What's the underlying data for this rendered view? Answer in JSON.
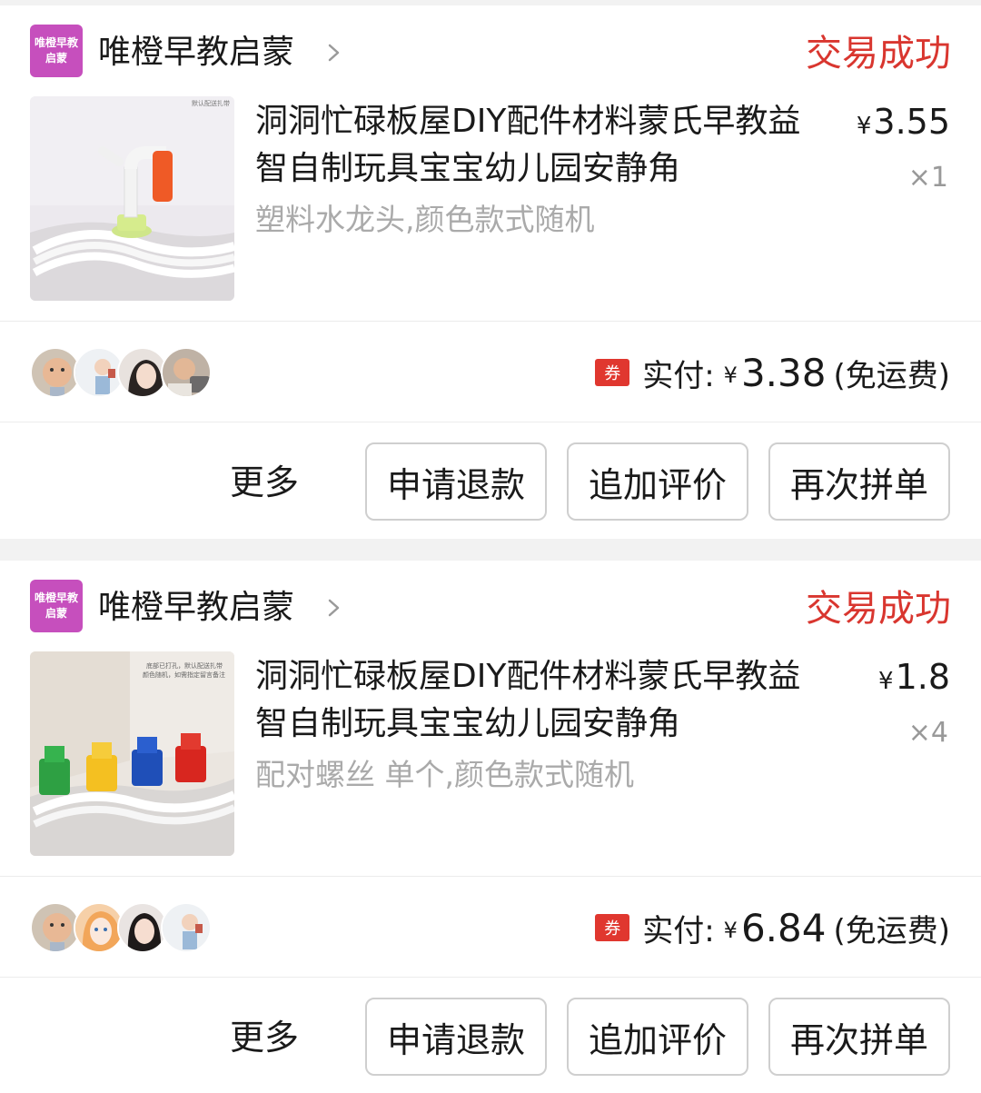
{
  "orders": [
    {
      "shop": {
        "logo_line1": "唯橙早教",
        "logo_line2": "启蒙",
        "name": "唯橙早教启蒙"
      },
      "status": "交易成功",
      "product": {
        "title": "洞洞忙碌板屋DIY配件材料蒙氏早教益智自制玩具宝宝幼儿园安静角",
        "spec": "塑料水龙头,颜色款式随机",
        "price_currency": "¥",
        "price": "3.55",
        "quantity": "×1",
        "image_caption": "默认配送扎带"
      },
      "payment": {
        "coupon": "券",
        "label": "实付:",
        "currency": "¥",
        "amount": "3.38",
        "note": "(免运费)"
      },
      "actions": {
        "more": "更多",
        "refund": "申请退款",
        "review": "追加评价",
        "reorder": "再次拼单"
      }
    },
    {
      "shop": {
        "logo_line1": "唯橙早教",
        "logo_line2": "启蒙",
        "name": "唯橙早教启蒙"
      },
      "status": "交易成功",
      "product": {
        "title": "洞洞忙碌板屋DIY配件材料蒙氏早教益智自制玩具宝宝幼儿园安静角",
        "spec": "配对螺丝 单个,颜色款式随机",
        "price_currency": "¥",
        "price": "1.8",
        "quantity": "×4",
        "image_caption_line1": "底部已打孔，默认配送扎带",
        "image_caption_line2": "颜色随机，如需指定留言备注"
      },
      "payment": {
        "coupon": "券",
        "label": "实付:",
        "currency": "¥",
        "amount": "6.84",
        "note": "(免运费)"
      },
      "actions": {
        "more": "更多",
        "refund": "申请退款",
        "review": "追加评价",
        "reorder": "再次拼单"
      }
    }
  ]
}
